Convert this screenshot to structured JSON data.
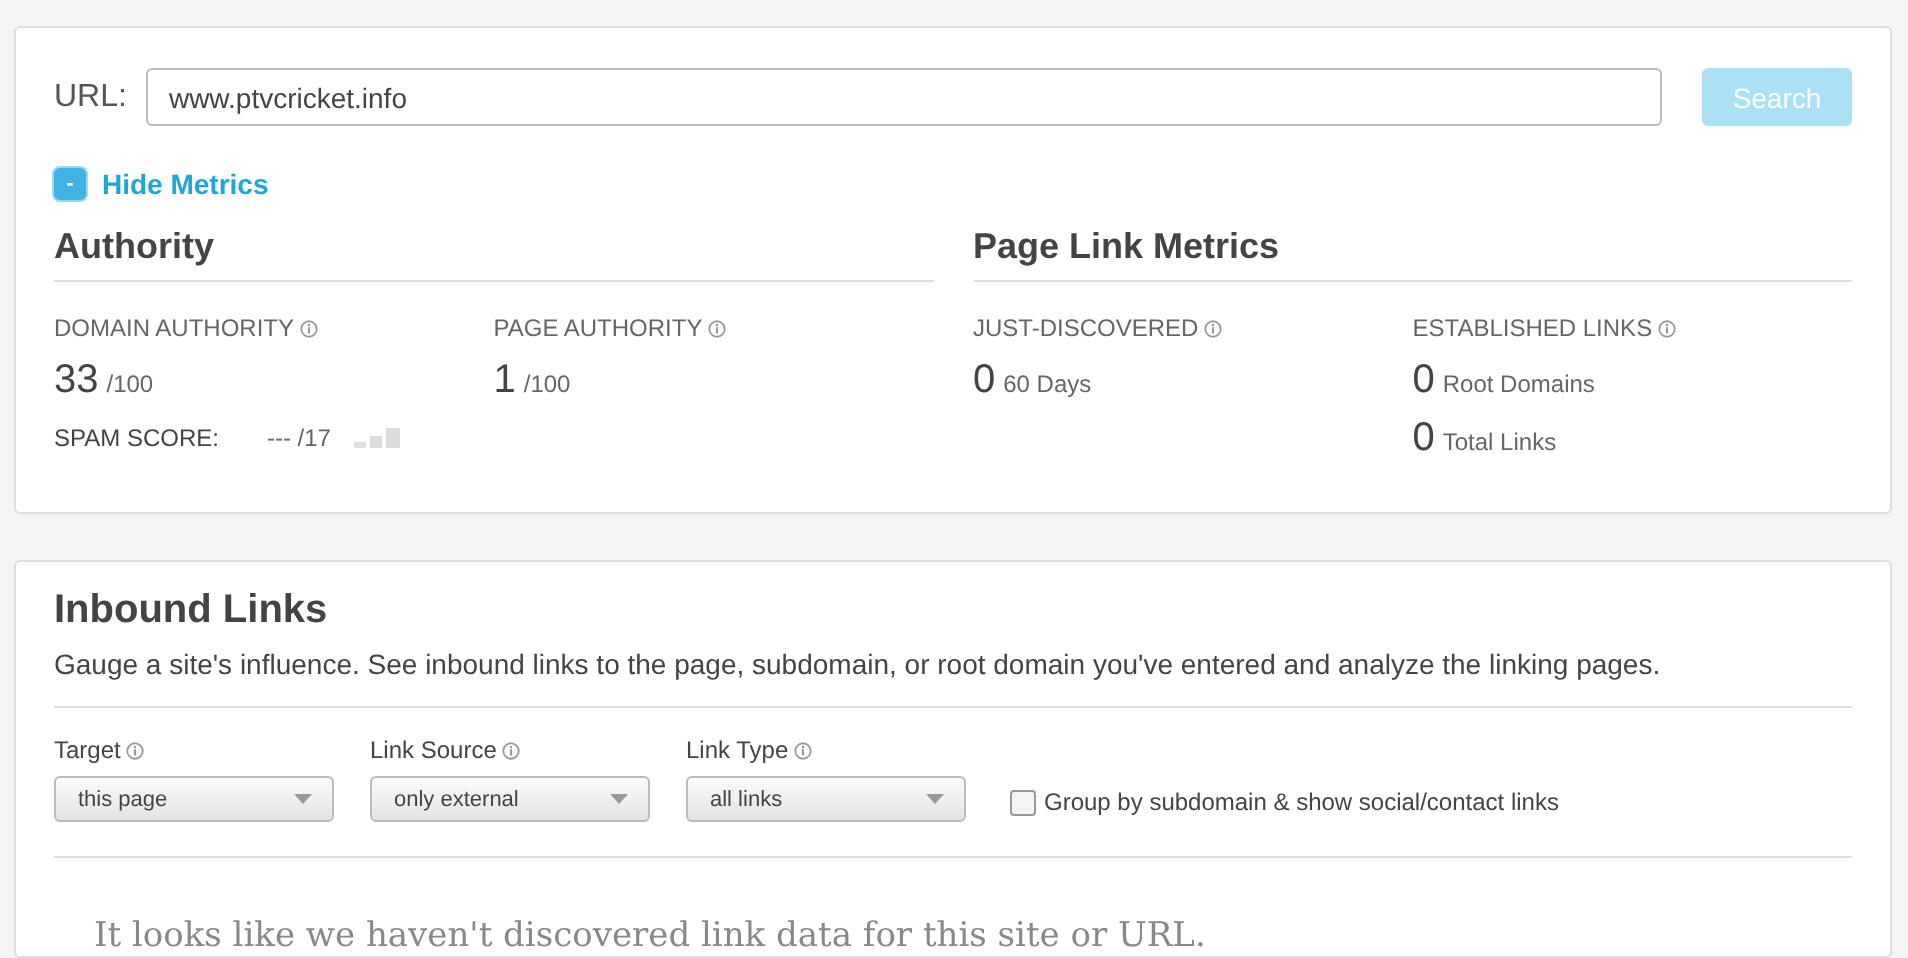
{
  "url_bar": {
    "label": "URL:",
    "value": "www.ptvcricket.info",
    "button": "Search",
    "button_disabled": true
  },
  "metrics_toggle": {
    "icon": "-",
    "label": "Hide Metrics",
    "expanded": true
  },
  "authority": {
    "title": "Authority",
    "metrics": [
      {
        "label": "DOMAIN AUTHORITY",
        "value": "33",
        "unit": "/100"
      },
      {
        "label": "PAGE AUTHORITY",
        "value": "1",
        "unit": "/100"
      }
    ],
    "spam": {
      "label": "SPAM SCORE:",
      "value": "--- /17"
    }
  },
  "page_link_metrics": {
    "title": "Page Link Metrics",
    "columns": [
      {
        "label": "JUST-DISCOVERED",
        "rows": [
          {
            "value": "0",
            "unit": "60 Days"
          }
        ]
      },
      {
        "label": "ESTABLISHED LINKS",
        "rows": [
          {
            "value": "0",
            "unit": "Root Domains"
          },
          {
            "value": "0",
            "unit": "Total Links"
          }
        ]
      }
    ]
  },
  "inbound": {
    "title": "Inbound Links",
    "description": "Gauge a site's influence. See inbound links to the page, subdomain, or root domain you've entered and analyze the linking pages.",
    "filters": [
      {
        "label": "Target",
        "value": "this page"
      },
      {
        "label": "Link Source",
        "value": "only external"
      },
      {
        "label": "Link Type",
        "value": "all links"
      }
    ],
    "group_option": {
      "label": "Group by subdomain & show social/contact links",
      "checked": false
    },
    "empty_message": "It looks like we haven't discovered link data for this site or URL."
  }
}
